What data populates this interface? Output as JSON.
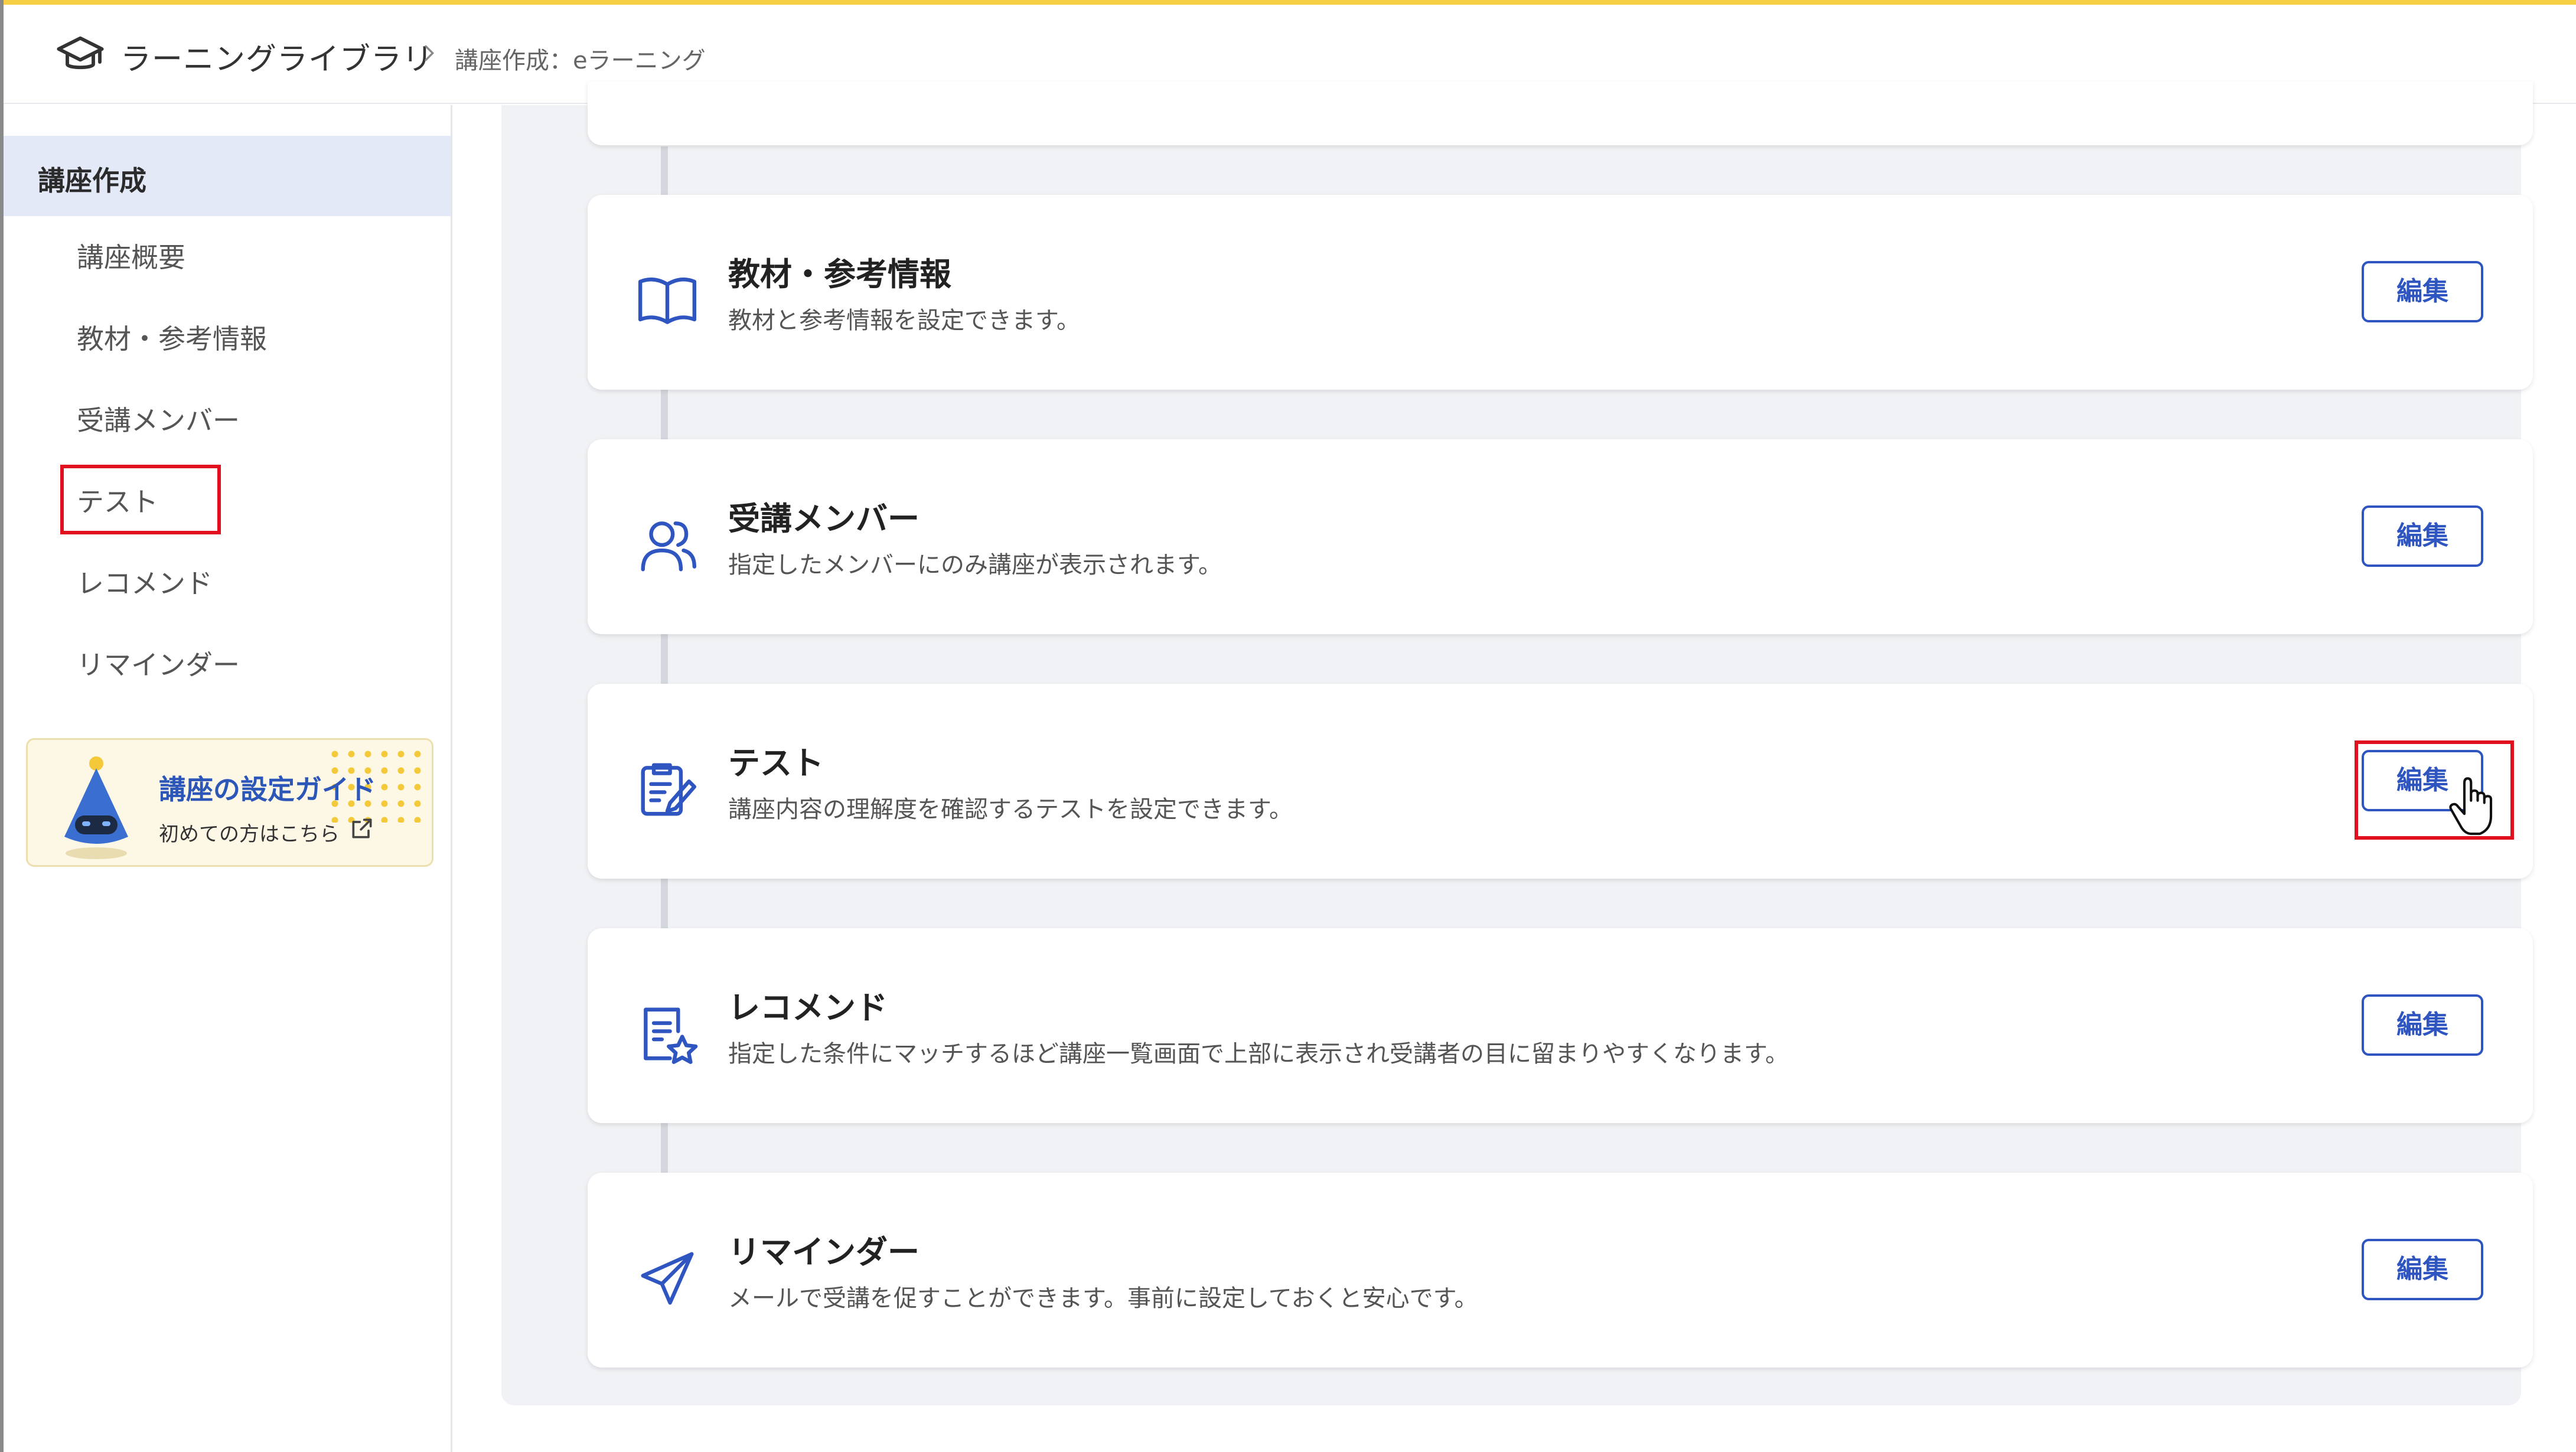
{
  "header": {
    "breadcrumb_root": "ラーニングライブラリ",
    "breadcrumb_current": "講座作成：eラーニング"
  },
  "sidebar": {
    "title": "講座作成",
    "items": [
      {
        "label": "講座概要"
      },
      {
        "label": "教材・参考情報"
      },
      {
        "label": "受講メンバー"
      },
      {
        "label": "テスト"
      },
      {
        "label": "レコメンド"
      },
      {
        "label": "リマインダー"
      }
    ],
    "guide": {
      "title": "講座の設定ガイド",
      "subtitle": "初めての方はこちら"
    }
  },
  "sections": [
    {
      "title": "教材・参考情報",
      "description": "教材と参考情報を設定できます。",
      "button": "編集",
      "icon": "book-icon"
    },
    {
      "title": "受講メンバー",
      "description": "指定したメンバーにのみ講座が表示されます。",
      "button": "編集",
      "icon": "users-icon"
    },
    {
      "title": "テスト",
      "description": "講座内容の理解度を確認するテストを設定できます。",
      "button": "編集",
      "icon": "test-edit-icon"
    },
    {
      "title": "レコメンド",
      "description": "指定した条件にマッチするほど講座一覧画面で上部に表示され受講者の目に留まりやすくなります。",
      "button": "編集",
      "icon": "recommend-star-icon"
    },
    {
      "title": "リマインダー",
      "description": "メールで受講を促すことができます。事前に設定しておくと安心です。",
      "button": "編集",
      "icon": "paper-plane-icon"
    }
  ],
  "colors": {
    "accent": "#2f56c0",
    "top_bar": "#f6cf45",
    "highlight": "#e0101e"
  }
}
